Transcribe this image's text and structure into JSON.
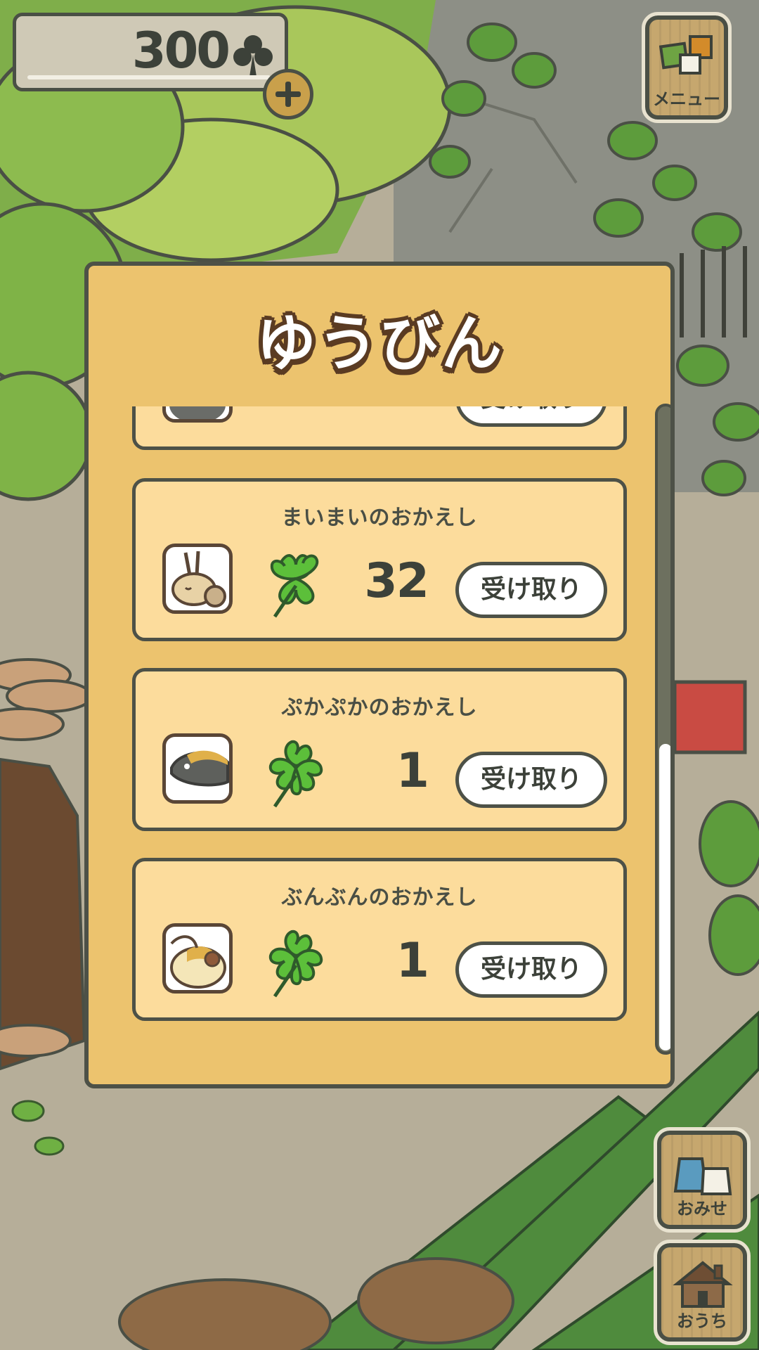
{
  "header": {
    "clover_count": "300",
    "add_label": "+"
  },
  "side_menu": {
    "menu_label": "メニュー",
    "shop_label": "おみせ",
    "home_label": "おうち"
  },
  "dialog": {
    "title": "ゆうびん",
    "scroll_position": 0.55,
    "top_partial_receive_label": "受け取り",
    "mail_items": [
      {
        "sender": "まいまいのおかえし",
        "amount": "32",
        "receive_label": "受け取り",
        "avatar": "snail-icon"
      },
      {
        "sender": "ぷかぷかのおかえし",
        "amount": "1",
        "receive_label": "受け取り",
        "avatar": "fish-icon"
      },
      {
        "sender": "ぶんぶんのおかえし",
        "amount": "1",
        "receive_label": "受け取り",
        "avatar": "bee-icon"
      }
    ]
  },
  "colors": {
    "dialog_bg": "#ecc36e",
    "card_bg": "#fcdc9c",
    "outline": "#4d5147",
    "clover_green": "#5cbf3a"
  }
}
